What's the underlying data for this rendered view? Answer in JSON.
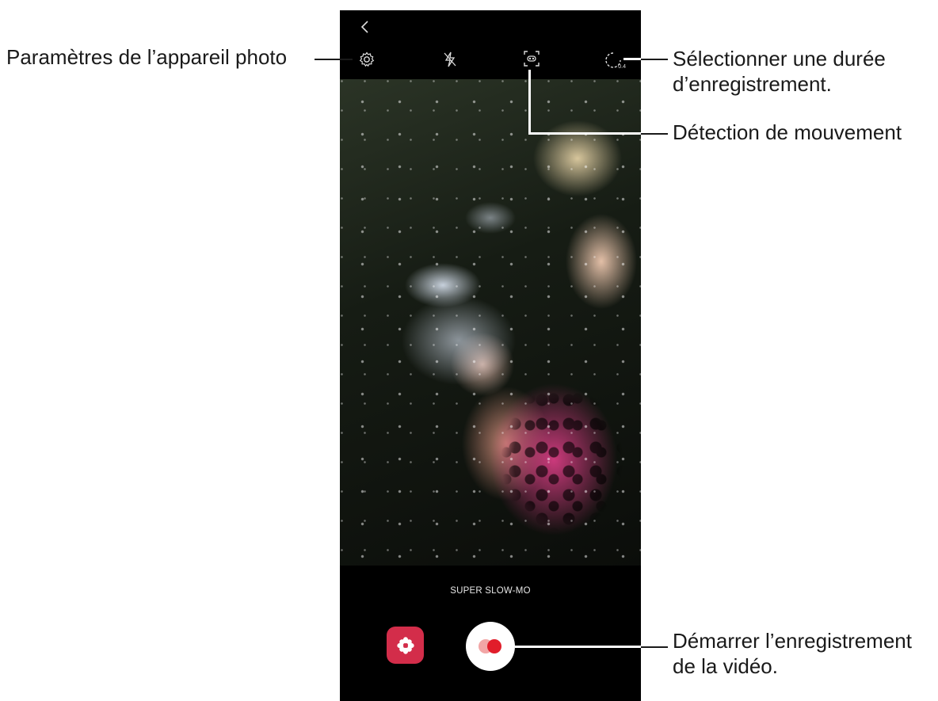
{
  "callouts": {
    "settings": "Paramètres de l’appareil photo",
    "duration_line1": "Sélectionner une durée",
    "duration_line2": "d’enregistrement.",
    "motion": "Détection de mouvement",
    "record_line1": "Démarrer l’enregistrement",
    "record_line2": "de la vidéo."
  },
  "camera": {
    "mode_label": "SUPER SLOW-MO",
    "duration_value": "0.4"
  },
  "icons": {
    "back": "back-arrow",
    "settings": "gear",
    "flash": "flash-off",
    "motion": "motion-detection-frame",
    "duration": "timer-dial",
    "effects": "flower",
    "record": "record"
  },
  "colors": {
    "effects_button": "#d32d4a",
    "record_dot": "#e11d2a"
  }
}
